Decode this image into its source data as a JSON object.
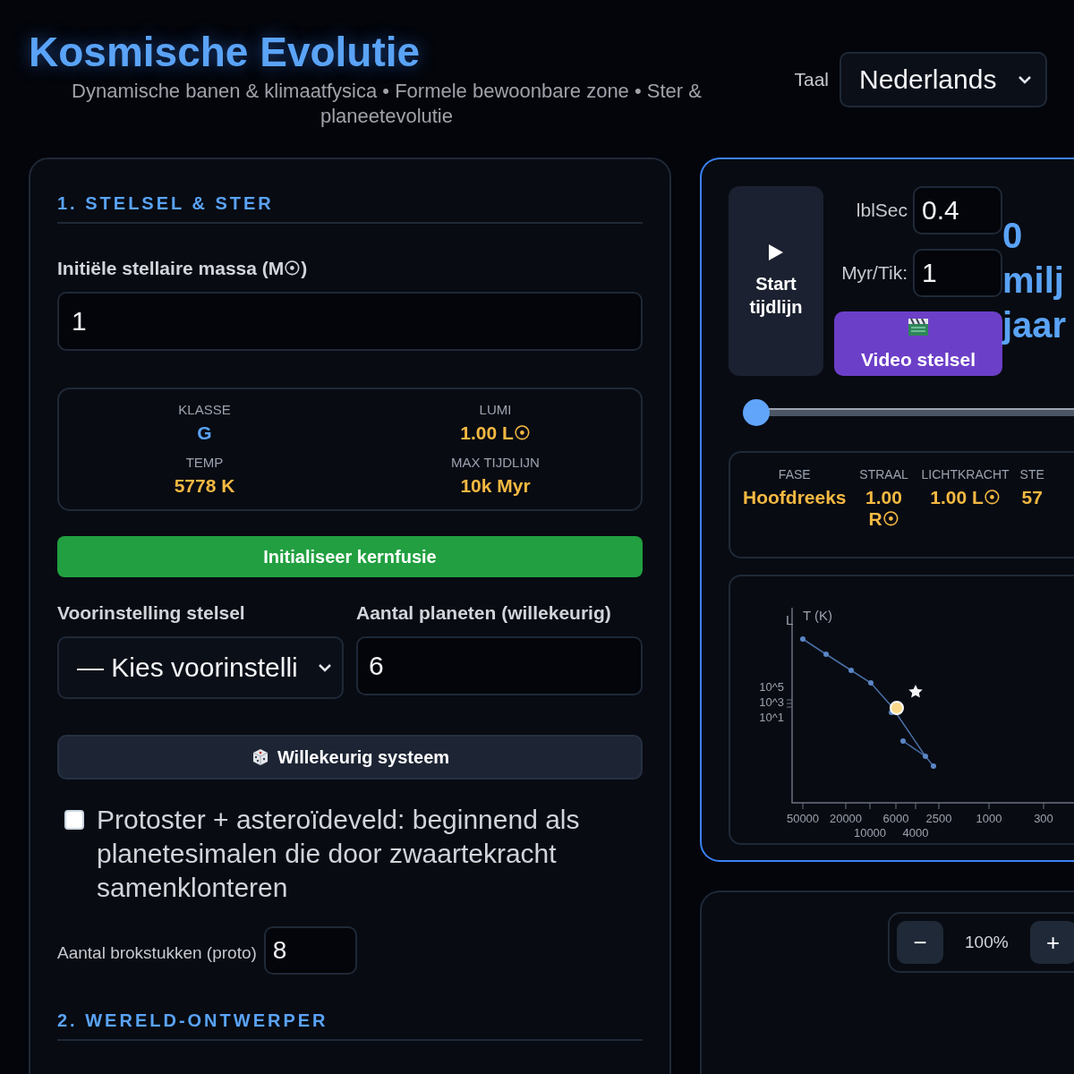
{
  "header": {
    "title": "Kosmische Evolutie",
    "subtitle": "Dynamische banen & klimaatfysica • Formele bewoonbare zone • Ster & planeetevolutie",
    "language_label": "Taal",
    "language_value": "Nederlands"
  },
  "left_panel": {
    "section_1_title": "1. STELSEL & STER",
    "mass_label": "Initiële stellaire massa (M☉)",
    "mass_value": "1",
    "star_stats": [
      {
        "label": "KLASSE",
        "value": "G",
        "kind": "class"
      },
      {
        "label": "LUMI",
        "value": "1.00 L☉",
        "kind": "amount"
      },
      {
        "label": "TEMP",
        "value": "5778 K",
        "kind": "amount"
      },
      {
        "label": "MAX TIJDLIJN",
        "value": "10k Myr",
        "kind": "amount"
      }
    ],
    "init_button": "Initialiseer kernfusie",
    "preset_label": "Voorinstelling stelsel",
    "preset_value": "— Kies voorinstelli",
    "planets_label": "Aantal planeten (willekeurig)",
    "planets_value": "6",
    "random_button": "Willekeurig systeem",
    "protostar": {
      "checked": false,
      "label": "Protoster + asteroïdeveld: beginnend als planetesimalen die door zwaartekracht samenklonteren"
    },
    "fragments_label": "Aantal brokstukken (proto)",
    "fragments_value": "8",
    "section_2_title": "2. WERELD-ONTWERPER"
  },
  "timeline_panel": {
    "start_button": "Start tijdlijn",
    "speed_label": "lblSec",
    "speed_value": "0.4",
    "step_label": "Myr/Tik:",
    "step_value": "1",
    "video_button": "Video stelsel",
    "age_readout": "0 milj jaar",
    "slider": {
      "level": 0
    },
    "stats": [
      {
        "label": "FASE",
        "value": "Hoofdreeks"
      },
      {
        "label": "STRAAL",
        "value": "1.00 R☉"
      },
      {
        "label": "LICHTKRACHT",
        "value": "1.00 L☉"
      },
      {
        "label": "STE",
        "value": "57"
      }
    ],
    "hr_diagram": {
      "y_axis_label": "L",
      "x_axis_label": "T (K)",
      "y_ticks": [
        "10^5",
        "10^3",
        "10^1"
      ],
      "x_ticks": [
        "50000",
        "20000",
        "10000",
        "6000",
        "4000",
        "2500",
        "1000",
        "300"
      ]
    }
  },
  "view_panel": {
    "zoom_out": "−",
    "zoom_level": "100%",
    "zoom_in": "+"
  }
}
